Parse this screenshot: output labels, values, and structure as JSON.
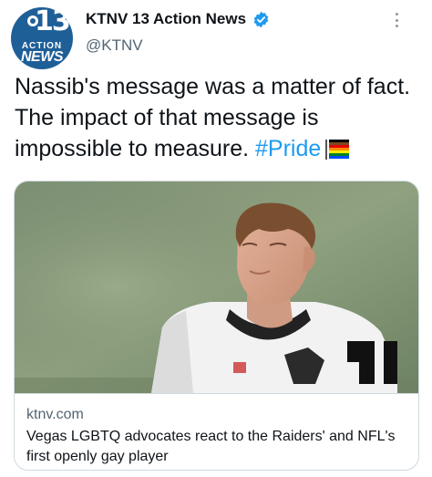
{
  "account": {
    "display_name": "KTNV 13 Action News",
    "handle": "@KTNV",
    "avatar": {
      "number": "13",
      "line1": "ACTION",
      "line2": "NEWS"
    },
    "verified_icon": "verified-badge-icon"
  },
  "tweet": {
    "text_plain": "Nassib's message was a matter of fact. The impact of that message is impossible to measure.",
    "hashtag": "#Pride",
    "emoji": "rainbow-flag-icon"
  },
  "link_card": {
    "domain": "ktnv.com",
    "title": "Vegas LGBTQ advocates react to the Raiders' and NFL's first openly gay player",
    "image": "football-player-photo"
  },
  "colors": {
    "accent": "#1d9bf0",
    "text": "#0f1419",
    "secondary": "#536471",
    "border": "#cfd9de"
  }
}
